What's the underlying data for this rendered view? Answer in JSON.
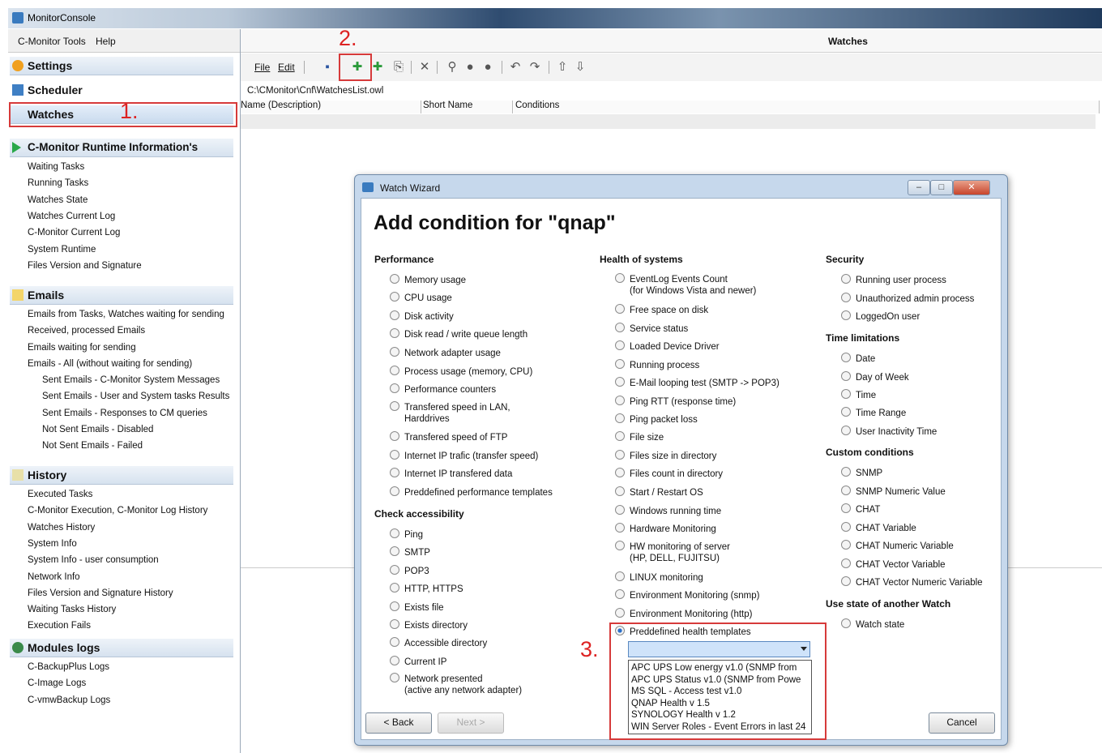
{
  "window": {
    "title": "MonitorConsole"
  },
  "menubar": {
    "items": [
      "C-Monitor Tools",
      "Help"
    ]
  },
  "sidebar": {
    "settings": "Settings",
    "scheduler": "Scheduler",
    "watches": "Watches",
    "runtime": {
      "title": "C-Monitor Runtime Information's",
      "items": [
        "Waiting Tasks",
        "Running Tasks",
        "Watches State",
        "Watches Current Log",
        "C-Monitor Current Log",
        "System Runtime",
        "Files Version and Signature"
      ]
    },
    "emails": {
      "title": "Emails",
      "items": [
        "Emails from Tasks, Watches waiting for sending",
        "Received, processed Emails",
        "Emails waiting for sending",
        "Emails - All (without waiting for sending)"
      ],
      "subitems": [
        "Sent Emails - C-Monitor System Messages",
        "Sent Emails - User and System tasks Results",
        "Sent Emails - Responses to CM queries",
        "Not Sent Emails - Disabled",
        "Not Sent Emails - Failed"
      ]
    },
    "history": {
      "title": "History",
      "items": [
        "Executed Tasks",
        "C-Monitor Execution, C-Monitor Log History",
        "Watches History",
        "System Info",
        "System Info - user consumption",
        "Network Info",
        "Files Version and Signature History",
        "Waiting Tasks History",
        "Execution Fails"
      ]
    },
    "modules": {
      "title": "Modules logs",
      "items": [
        "C-BackupPlus Logs",
        "C-Image Logs",
        "C-vmwBackup Logs"
      ]
    }
  },
  "main": {
    "header": "Watches",
    "menu": [
      "File",
      "Edit"
    ],
    "path": "C:\\CMonitor\\Cnf\\WatchesList.owl",
    "columns": [
      "Name (Description)",
      "Short Name",
      "Conditions"
    ]
  },
  "annotations": [
    "1.",
    "2.",
    "3."
  ],
  "wizard": {
    "title": "Watch Wizard",
    "heading": "Add condition for \"qnap\"",
    "performance": {
      "title": "Performance",
      "items": [
        "Memory usage",
        "CPU usage",
        "Disk activity",
        "Disk read / write queue length",
        "Network adapter usage",
        "Process usage (memory, CPU)",
        "Performance counters",
        "Transfered speed in LAN,",
        "Transfered speed of FTP",
        "Internet IP trafic (transfer speed)",
        "Internet IP transfered data",
        "Preddefined performance templates"
      ],
      "item8_line2": "Harddrives"
    },
    "accessibility": {
      "title": "Check accessibility",
      "items": [
        "Ping",
        "SMTP",
        "POP3",
        "HTTP, HTTPS",
        "Exists file",
        "Exists directory",
        "Accessible directory",
        "Current IP",
        "Network presented"
      ],
      "item9_line2": "(active any network adapter)"
    },
    "health": {
      "title": "Health of systems",
      "items": [
        "EventLog Events Count",
        "Free space on disk",
        "Service status",
        "Loaded Device Driver",
        "Running process",
        "E-Mail looping test (SMTP -> POP3)",
        "Ping RTT (response time)",
        "Ping packet loss",
        "File size",
        "Files size in directory",
        "Files count in directory",
        "Start / Restart OS",
        "Windows running time",
        "Hardware Monitoring",
        "HW monitoring of server",
        "LINUX monitoring",
        "Environment Monitoring (snmp)",
        "Environment Monitoring (http)",
        "Preddefined health templates"
      ],
      "item1_line2": "(for Windows Vista and newer)",
      "item15_line2": "(HP, DELL, FUJITSU)",
      "selected": "Preddefined health templates"
    },
    "security": {
      "title": "Security",
      "items": [
        "Running user process",
        "Unauthorized admin process",
        "LoggedOn user"
      ]
    },
    "time": {
      "title": "Time limitations",
      "items": [
        "Date",
        "Day of Week",
        "Time",
        "Time Range",
        "User Inactivity Time"
      ]
    },
    "custom": {
      "title": "Custom conditions",
      "items": [
        "SNMP",
        "SNMP Numeric Value",
        "CHAT",
        "CHAT Variable",
        "CHAT Numeric Variable",
        "CHAT Vector Variable",
        "CHAT Vector Numeric Variable"
      ]
    },
    "otherwatch": {
      "title": "Use state of another Watch",
      "items": [
        "Watch state"
      ]
    },
    "templates": [
      "APC UPS Low energy v1.0 (SNMP from",
      "APC UPS Status v1.0 (SNMP from Powe",
      "MS SQL - Access test v1.0",
      "QNAP Health v 1.5",
      "SYNOLOGY Health v 1.2",
      "WIN Server Roles - Event Errors in last 24"
    ],
    "buttons": {
      "back": "< Back",
      "next": "Next >",
      "cancel": "Cancel"
    }
  }
}
